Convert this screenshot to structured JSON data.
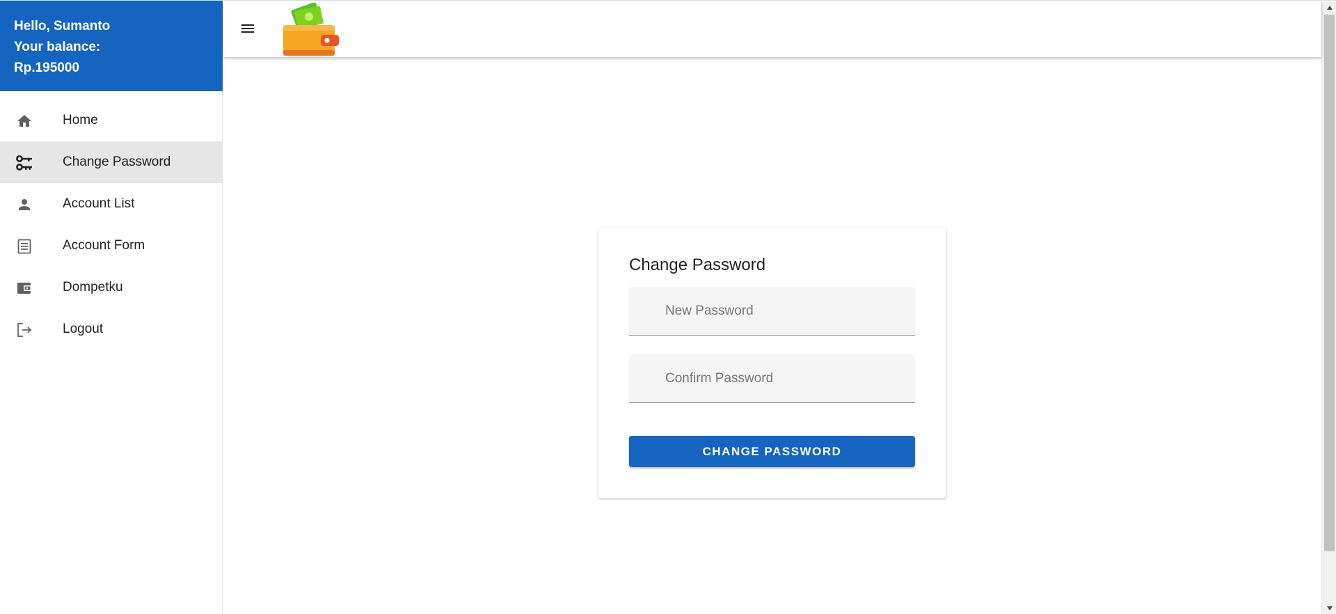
{
  "sidebar": {
    "greeting": "Hello, Sumanto",
    "balance_label": "Your balance:",
    "balance_value": "Rp.195000",
    "items": [
      {
        "label": "Home",
        "icon": "home-icon",
        "active": false
      },
      {
        "label": "Change Password",
        "icon": "key-icon",
        "active": true
      },
      {
        "label": "Account List",
        "icon": "person-icon",
        "active": false
      },
      {
        "label": "Account Form",
        "icon": "form-icon",
        "active": false
      },
      {
        "label": "Dompetku",
        "icon": "wallet-icon",
        "active": false
      },
      {
        "label": "Logout",
        "icon": "logout-icon",
        "active": false
      }
    ]
  },
  "topbar": {
    "menu_icon": "hamburger-menu-icon",
    "logo_icon": "wallet-logo-icon"
  },
  "form": {
    "title": "Change Password",
    "new_password": {
      "placeholder": "New Password",
      "value": ""
    },
    "confirm_password": {
      "placeholder": "Confirm Password",
      "value": ""
    },
    "submit_label": "CHANGE PASSWORD"
  },
  "colors": {
    "primary": "#1565c0",
    "active_nav_bg": "#e6e6e6",
    "icon_gray": "#616161"
  }
}
